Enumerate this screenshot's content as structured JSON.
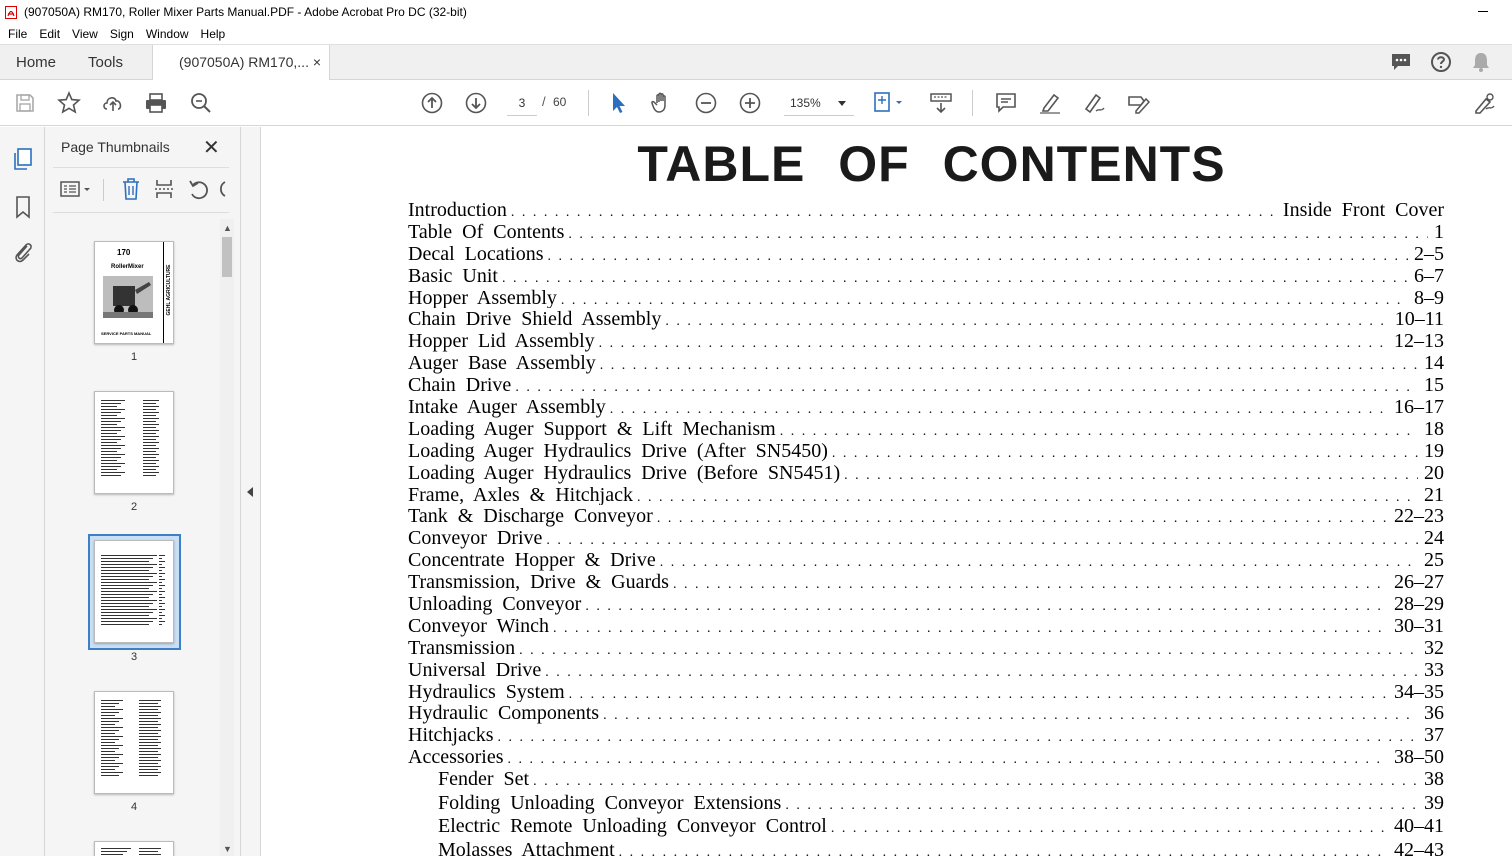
{
  "window": {
    "title": "(907050A) RM170, Roller Mixer Parts Manual.PDF - Adobe Acrobat Pro DC (32-bit)"
  },
  "menu": [
    "File",
    "Edit",
    "View",
    "Sign",
    "Window",
    "Help"
  ],
  "tabs": {
    "home": "Home",
    "tools": "Tools",
    "document": "(907050A) RM170,...",
    "close": "×"
  },
  "toolbar": {
    "current_page": "3",
    "page_separator": "/",
    "total_pages": "60",
    "zoom": "135%"
  },
  "icons": {
    "left_tools": [
      "save-icon",
      "bookmark-star-icon",
      "upload-icon",
      "print-icon",
      "search-zoom-icon"
    ],
    "nav": [
      "previous-page-icon",
      "next-page-icon"
    ],
    "mode": [
      "select-pointer-icon",
      "hand-icon",
      "zoom-out-icon",
      "zoom-in-icon"
    ],
    "right": [
      "comment-icon",
      "highlight-pen-icon",
      "draw-icon",
      "stamp-icon",
      "share-icon"
    ],
    "tabbar_right": [
      "chat-icon",
      "help-icon",
      "notification-bell-icon"
    ]
  },
  "colors": {
    "accent": "#3e7fc6",
    "selected_thumb_bg": "#c9dff5",
    "icon": "#555555"
  },
  "thumbnail_panel": {
    "title": "Page Thumbnails",
    "close": "✕",
    "pages": [
      {
        "num": "1",
        "cover_number": "170",
        "cover_title": "RollerMixer",
        "cover_footer": "SERVICE PARTS MANUAL",
        "cover_side": "GEHL AGRICULTURE"
      },
      {
        "num": "2"
      },
      {
        "num": "3",
        "selected": true
      },
      {
        "num": "4"
      }
    ]
  },
  "document": {
    "heading": "TABLE OF CONTENTS",
    "entries": [
      {
        "label": "Introduction",
        "page": "Inside Front Cover",
        "indent": false
      },
      {
        "label": "Table Of Contents",
        "page": "1",
        "indent": false
      },
      {
        "label": "Decal Locations",
        "page": "2–5",
        "indent": false
      },
      {
        "label": "Basic Unit",
        "page": "6–7",
        "indent": false
      },
      {
        "label": "Hopper Assembly",
        "page": "8–9",
        "indent": false
      },
      {
        "label": "Chain Drive Shield Assembly",
        "page": "10–11",
        "indent": false
      },
      {
        "label": "Hopper Lid Assembly",
        "page": "12–13",
        "indent": false
      },
      {
        "label": "Auger Base Assembly",
        "page": "14",
        "indent": false
      },
      {
        "label": "Chain Drive",
        "page": "15",
        "indent": false
      },
      {
        "label": "Intake Auger Assembly",
        "page": "16–17",
        "indent": false
      },
      {
        "label": "Loading Auger Support & Lift Mechanism",
        "page": "18",
        "indent": false
      },
      {
        "label": "Loading Auger Hydraulics Drive (After SN5450)",
        "page": "19",
        "indent": false
      },
      {
        "label": "Loading Auger Hydraulics Drive (Before SN5451)",
        "page": "20",
        "indent": false
      },
      {
        "label": "Frame, Axles & Hitchjack",
        "page": "21",
        "indent": false
      },
      {
        "label": "Tank & Discharge Conveyor",
        "page": "22–23",
        "indent": false
      },
      {
        "label": "Conveyor Drive",
        "page": "24",
        "indent": false
      },
      {
        "label": "Concentrate Hopper & Drive",
        "page": "25",
        "indent": false
      },
      {
        "label": "Transmission, Drive & Guards",
        "page": "26–27",
        "indent": false
      },
      {
        "label": "Unloading Conveyor",
        "page": "28–29",
        "indent": false
      },
      {
        "label": "Conveyor Winch",
        "page": "30–31",
        "indent": false
      },
      {
        "label": "Transmission",
        "page": "32",
        "indent": false
      },
      {
        "label": "Universal Drive",
        "page": "33",
        "indent": false
      },
      {
        "label": "Hydraulics System",
        "page": "34–35",
        "indent": false
      },
      {
        "label": "Hydraulic Components",
        "page": "36",
        "indent": false
      },
      {
        "label": "Hitchjacks",
        "page": "37",
        "indent": false
      },
      {
        "label": "Accessories",
        "page": "38–50",
        "indent": false
      },
      {
        "label": "Fender Set",
        "page": "38",
        "indent": true
      },
      {
        "label": "Folding Unloading Conveyor Extensions",
        "page": "39",
        "indent": true
      },
      {
        "label": "Electric Remote Unloading Conveyor Control",
        "page": "40–41",
        "indent": true
      },
      {
        "label": "Molasses Attachment",
        "page": "42–43",
        "indent": true
      }
    ]
  }
}
